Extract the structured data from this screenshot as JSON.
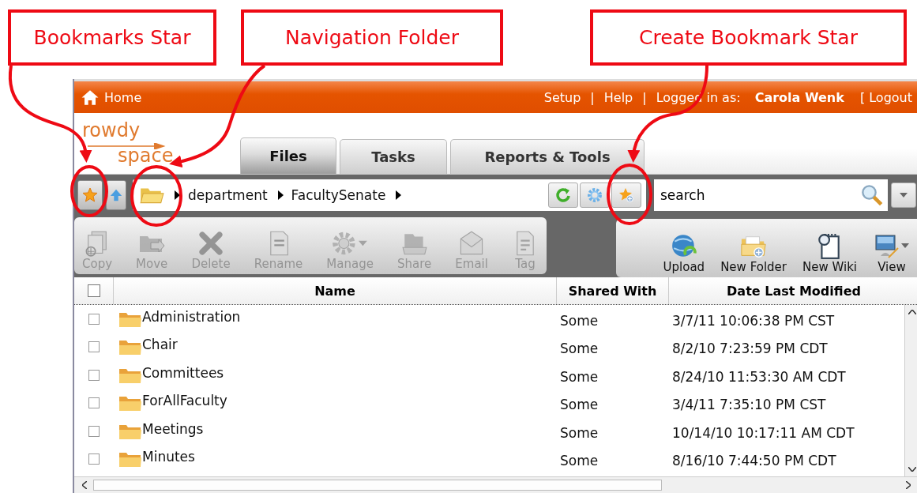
{
  "callouts": [
    {
      "label": "Bookmarks Star"
    },
    {
      "label": "Navigation Folder"
    },
    {
      "label": "Create Bookmark Star"
    }
  ],
  "header": {
    "home": "Home",
    "links": [
      "Setup",
      "Help"
    ],
    "separator": "|",
    "logged_in_label": "Logged in as:",
    "user": "Carola Wenk",
    "logout": "[ Logout"
  },
  "logo": {
    "line_1": "rowdy",
    "line_2": "space"
  },
  "tabs": [
    {
      "label": "Files",
      "selected": true
    },
    {
      "label": "Tasks",
      "selected": false
    },
    {
      "label": "Reports & Tools",
      "selected": false
    }
  ],
  "breadcrumb": [
    "department",
    "FacultySenate"
  ],
  "search": {
    "value": "search"
  },
  "file_actions": [
    {
      "label": "Copy",
      "kind": "copy",
      "disabled": true
    },
    {
      "label": "Move",
      "kind": "move",
      "disabled": true
    },
    {
      "label": "Delete",
      "kind": "delete",
      "disabled": true
    },
    {
      "label": "Rename",
      "kind": "rename",
      "disabled": true
    },
    {
      "label": "Manage",
      "kind": "manage",
      "disabled": true
    },
    {
      "label": "Share",
      "kind": "share",
      "disabled": true
    },
    {
      "label": "Email",
      "kind": "email",
      "disabled": true
    },
    {
      "label": "Tag",
      "kind": "tag",
      "disabled": true
    }
  ],
  "create_actions": [
    {
      "label": "Upload",
      "kind": "upload",
      "disabled": false
    },
    {
      "label": "New Folder",
      "kind": "folder",
      "disabled": false
    },
    {
      "label": "New Wiki",
      "kind": "wiki",
      "disabled": false
    },
    {
      "label": "View",
      "kind": "view",
      "disabled": false
    }
  ],
  "table": {
    "select_all_checked": false,
    "columns": [
      "Name",
      "Shared With",
      "Date Last Modified"
    ],
    "rows": [
      {
        "name": "Administration",
        "shared": "Some",
        "modified": "3/7/11 10:06:38 PM CST",
        "checked": false
      },
      {
        "name": "Chair",
        "shared": "Some",
        "modified": "8/2/10 7:23:59 PM CDT",
        "checked": false
      },
      {
        "name": "Committees",
        "shared": "Some",
        "modified": "8/24/10 11:53:30 AM CDT",
        "checked": false
      },
      {
        "name": "ForAllFaculty",
        "shared": "Some",
        "modified": "3/4/11 7:35:10 PM CST",
        "checked": false
      },
      {
        "name": "Meetings",
        "shared": "Some",
        "modified": "10/14/10 10:17:11 AM CDT",
        "checked": false
      },
      {
        "name": "Minutes",
        "shared": "Some",
        "modified": "8/16/10 7:44:50 PM CDT",
        "checked": false
      }
    ]
  }
}
